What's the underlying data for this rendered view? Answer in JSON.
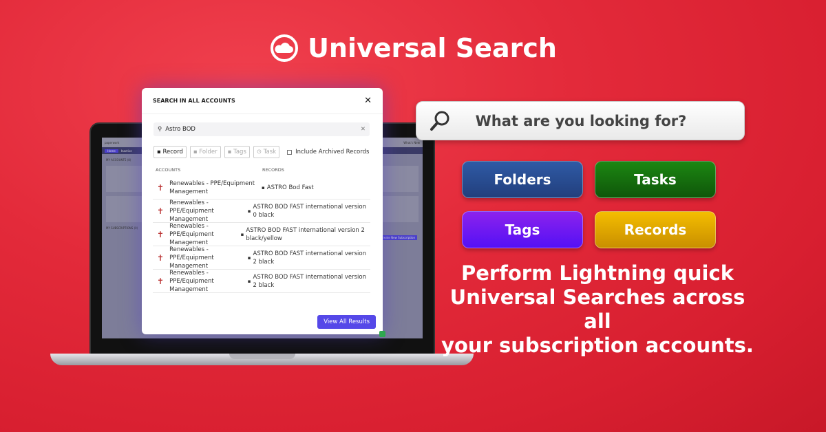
{
  "title": "Universal Search",
  "laptop": {
    "logo": "paperwork",
    "nav": [
      "Home",
      "Inactive"
    ],
    "whats_new": "What's New",
    "my_accounts": "MY ACCOUNTS (8)",
    "my_subscriptions": "MY SUBSCRIPTIONS (0)",
    "create_button": "Create New Subscription"
  },
  "modal": {
    "title": "SEARCH IN ALL ACCOUNTS",
    "search_value": "Astro BOD",
    "filters": [
      {
        "label": "Record",
        "active": true
      },
      {
        "label": "Folder",
        "active": false
      },
      {
        "label": "Tags",
        "active": false
      },
      {
        "label": "Task",
        "active": false
      }
    ],
    "archived_label": "Include Archived Records",
    "archived_checked": false,
    "col_accounts": "ACCOUNTS",
    "col_records": "RECORDS",
    "rows": [
      {
        "account": "Renewables - PPE/Equipment Management",
        "record": "ASTRO Bod Fast"
      },
      {
        "account": "Renewables - PPE/Equipment Management",
        "record": "ASTRO BOD FAST international version 0 black"
      },
      {
        "account": "Renewables - PPE/Equipment Management",
        "record": "ASTRO BOD FAST international version 2 black/yellow"
      },
      {
        "account": "Renewables - PPE/Equipment Management",
        "record": "ASTRO BOD FAST international version 2 black"
      },
      {
        "account": "Renewables - PPE/Equipment Management",
        "record": "ASTRO BOD FAST international version 2 black"
      }
    ],
    "view_all": "View All Results"
  },
  "search_prompt": "What are you looking for?",
  "categories": [
    {
      "label": "Folders",
      "color": "#2a4f93"
    },
    {
      "label": "Tasks",
      "color": "#166b0e"
    },
    {
      "label": "Tags",
      "color": "#6a1cf0"
    },
    {
      "label": "Records",
      "color": "#e1a800"
    }
  ],
  "tagline": [
    "Perform Lightning quick",
    "Universal Searches across all",
    "your subscription accounts."
  ],
  "colors": {
    "background": "#e32a3a",
    "accent": "#5548e8"
  }
}
